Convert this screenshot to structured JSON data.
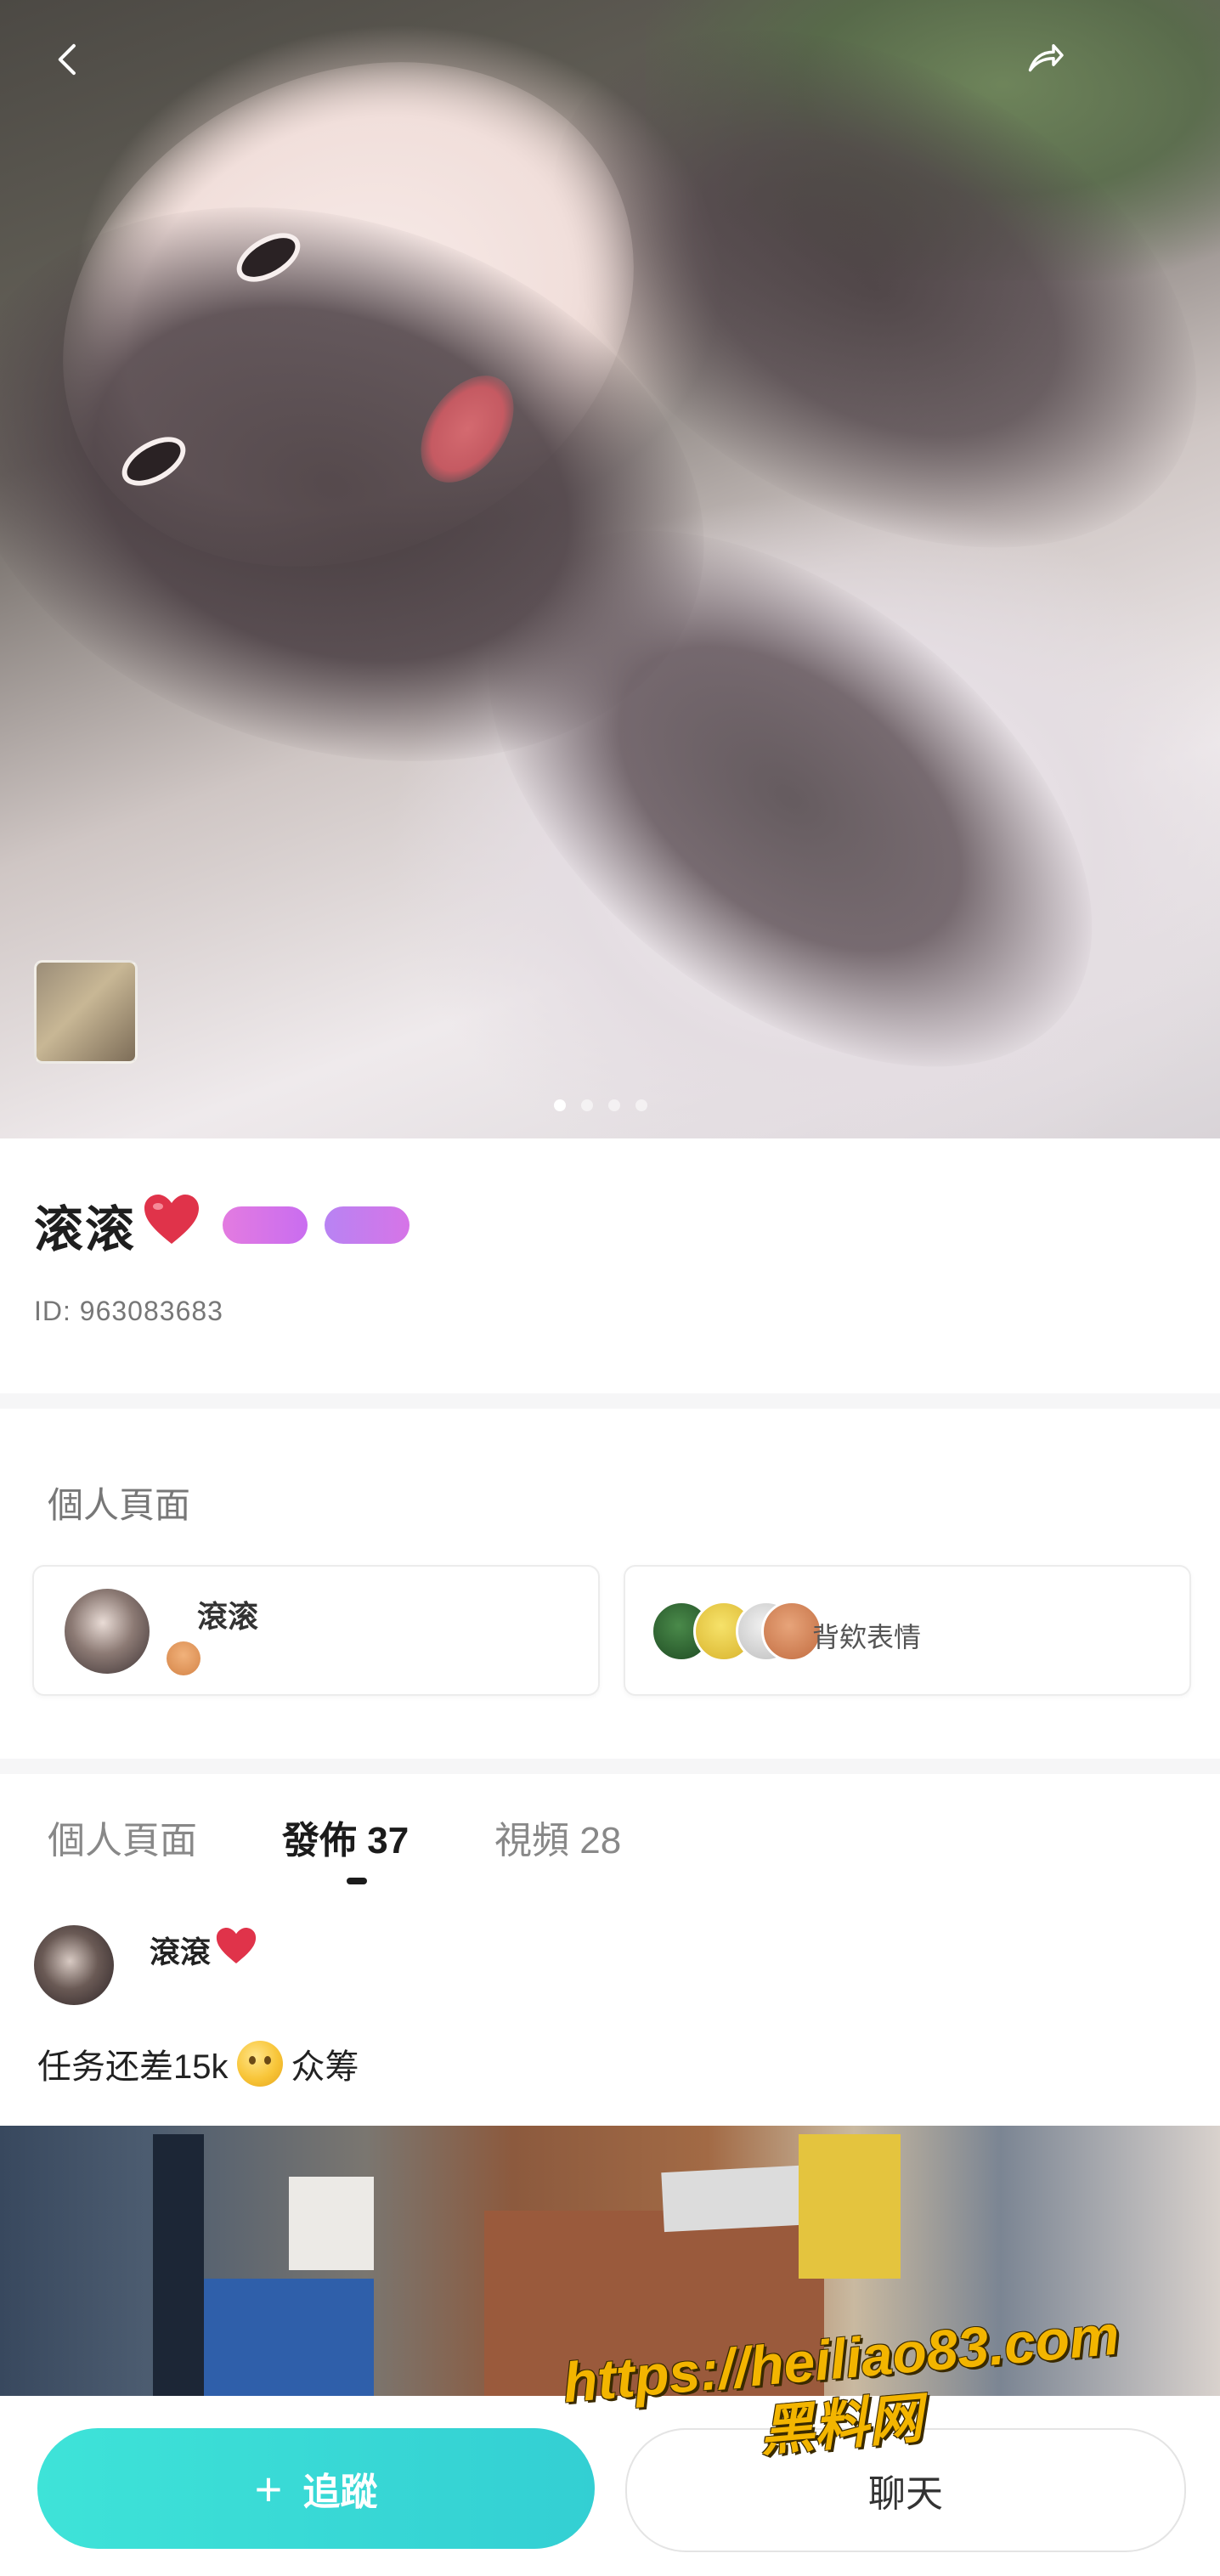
{
  "profile": {
    "name": "滚滚",
    "id_text": "ID: 963083683",
    "badges": [
      "",
      ""
    ]
  },
  "gallery": {
    "dot_count": 4,
    "active_index": 0
  },
  "section": {
    "title": "個人頁面"
  },
  "cards": {
    "left": {
      "name": "滾滚",
      "sub": ""
    },
    "right": {
      "label": "背欸表情"
    }
  },
  "tabs": [
    {
      "label": "個人頁面"
    },
    {
      "label": "發佈 37"
    },
    {
      "label": "視頻 28"
    }
  ],
  "post": {
    "author": "滾滾",
    "text_before": "任务还差15k",
    "text_after": "众筹"
  },
  "actions": {
    "follow_label": "追蹤",
    "chat_label": "聊天"
  },
  "watermark": {
    "url": "https://heiliao83.com",
    "name": "黑料网"
  },
  "colors": {
    "accent": "#3ee3d8",
    "heart": "#e0334a",
    "badge_pink": "#e37be0",
    "badge_purple": "#b883f3"
  }
}
